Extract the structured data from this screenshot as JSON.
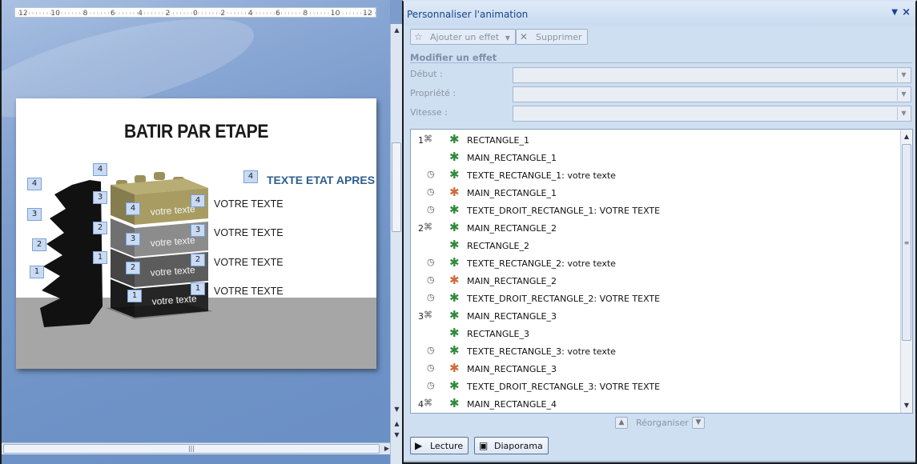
{
  "ruler": {
    "labels": [
      "12",
      "10",
      "8",
      "6",
      "4",
      "2",
      "0",
      "2",
      "4",
      "6",
      "8",
      "10",
      "12"
    ]
  },
  "slide": {
    "title": "BATIR PAR ETAPE",
    "texte_etat": "TEXTE ETAT APRES",
    "votre_texte": [
      "VOTRE TEXTE",
      "VOTRE TEXTE",
      "VOTRE TEXTE",
      "VOTRE TEXTE"
    ],
    "block_text": "votre texte",
    "block_colors": [
      "#a89c62",
      "#8c8c8c",
      "#5c5c5c",
      "#262626"
    ],
    "tags": [
      "4",
      "4",
      "3",
      "3",
      "4",
      "4",
      "2",
      "2",
      "3",
      "3",
      "1",
      "1",
      "2",
      "2",
      "1",
      "1",
      "4"
    ]
  },
  "pane": {
    "title": "Personnaliser l'animation",
    "add_effect": "Ajouter un effet",
    "delete": "Supprimer",
    "modify_label": "Modifier un effet",
    "start_label": "Début :",
    "property_label": "Propriété :",
    "speed_label": "Vitesse :",
    "reorder_label": "Réorganiser",
    "play_label": "Lecture",
    "slideshow_label": "Diaporama",
    "colors": {
      "entrance": "#2f8a3a",
      "emphasis": "#d46a3a"
    },
    "animations": [
      {
        "num": "1",
        "trigger": "click",
        "effect": "entrance",
        "name": "RECTANGLE_1"
      },
      {
        "num": "",
        "trigger": "with",
        "effect": "entrance",
        "name": "MAIN_RECTANGLE_1"
      },
      {
        "num": "",
        "trigger": "after",
        "effect": "entrance",
        "name": "TEXTE_RECTANGLE_1: votre texte"
      },
      {
        "num": "",
        "trigger": "after",
        "effect": "emphasis",
        "name": "MAIN_RECTANGLE_1"
      },
      {
        "num": "",
        "trigger": "after",
        "effect": "entrance",
        "name": "TEXTE_DROIT_RECTANGLE_1: VOTRE TEXTE"
      },
      {
        "num": "2",
        "trigger": "click",
        "effect": "entrance",
        "name": "MAIN_RECTANGLE_2"
      },
      {
        "num": "",
        "trigger": "with",
        "effect": "entrance",
        "name": "RECTANGLE_2"
      },
      {
        "num": "",
        "trigger": "after",
        "effect": "entrance",
        "name": "TEXTE_RECTANGLE_2: votre texte"
      },
      {
        "num": "",
        "trigger": "after",
        "effect": "emphasis",
        "name": "MAIN_RECTANGLE_2"
      },
      {
        "num": "",
        "trigger": "after",
        "effect": "entrance",
        "name": "TEXTE_DROIT_RECTANGLE_2: VOTRE TEXTE"
      },
      {
        "num": "3",
        "trigger": "click",
        "effect": "entrance",
        "name": "MAIN_RECTANGLE_3"
      },
      {
        "num": "",
        "trigger": "with",
        "effect": "entrance",
        "name": "RECTANGLE_3"
      },
      {
        "num": "",
        "trigger": "after",
        "effect": "entrance",
        "name": "TEXTE_RECTANGLE_3: votre texte"
      },
      {
        "num": "",
        "trigger": "after",
        "effect": "emphasis",
        "name": "MAIN_RECTANGLE_3"
      },
      {
        "num": "",
        "trigger": "after",
        "effect": "entrance",
        "name": "TEXTE_DROIT_RECTANGLE_3: VOTRE TEXTE"
      },
      {
        "num": "4",
        "trigger": "click",
        "effect": "entrance",
        "name": "MAIN_RECTANGLE_4"
      }
    ]
  }
}
